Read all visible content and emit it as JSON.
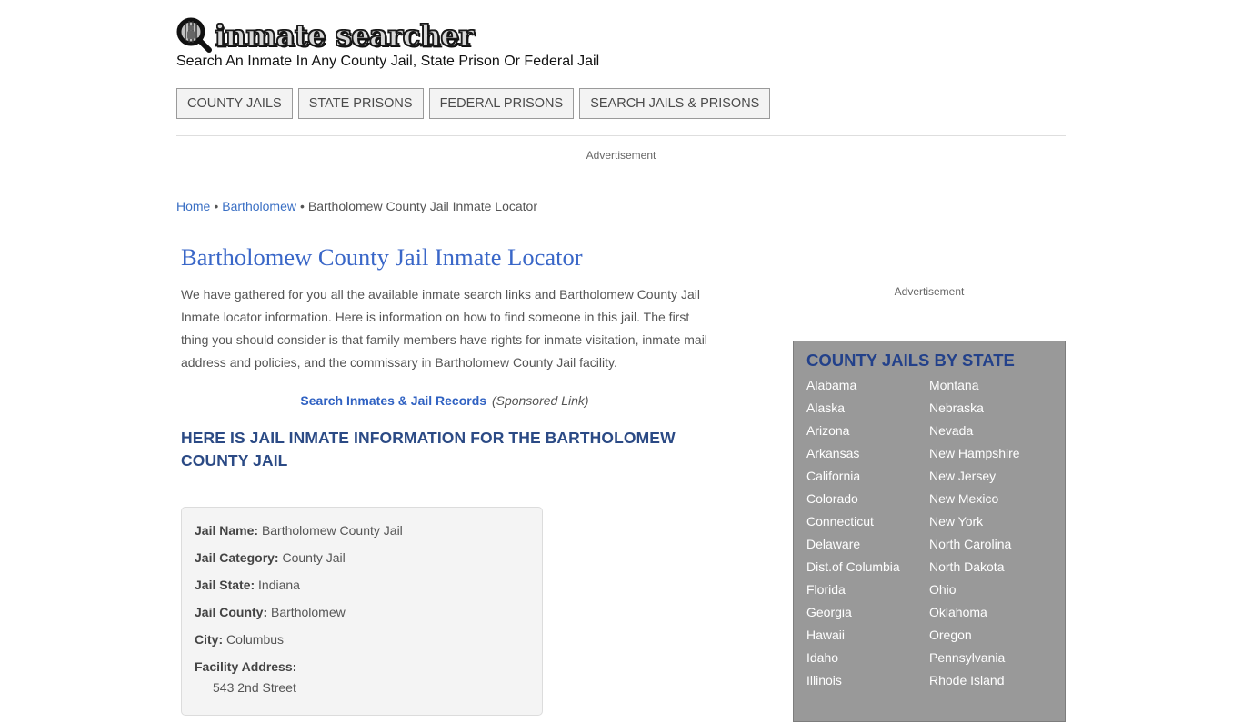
{
  "header": {
    "logo_text": "inmate searcher",
    "tagline": "Search An Inmate In Any County Jail, State Prison Or Federal Jail"
  },
  "nav": {
    "items": [
      {
        "label": "COUNTY JAILS"
      },
      {
        "label": "STATE PRISONS"
      },
      {
        "label": "FEDERAL PRISONS"
      },
      {
        "label": "SEARCH JAILS & PRISONS"
      }
    ]
  },
  "ads": {
    "top_label": "Advertisement",
    "side_label": "Advertisement"
  },
  "breadcrumb": {
    "home": "Home",
    "county": "Bartholomew",
    "current": "Bartholomew County Jail Inmate Locator",
    "separator": "•"
  },
  "main": {
    "title": "Bartholomew County Jail Inmate Locator",
    "intro": "We have gathered for you all the available inmate search links and Bartholomew County Jail Inmate locator information. Here is information on how to find someone in this jail. The first thing you should consider is that family members have rights for inmate visitation, inmate mail address and policies, and the commissary in Bartholomew County Jail facility.",
    "sponsored_link": "Search Inmates & Jail Records",
    "sponsored_note": "(Sponsored Link)",
    "section_heading": "HERE IS JAIL INMATE INFORMATION FOR THE BARTHOLOMEW COUNTY JAIL"
  },
  "info": {
    "jail_name_label": "Jail Name:",
    "jail_name": "Bartholomew County Jail",
    "category_label": "Jail Category:",
    "category": "County Jail",
    "state_label": "Jail State:",
    "state": "Indiana",
    "county_label": "Jail County:",
    "county": "Bartholomew",
    "city_label": "City:",
    "city": "Columbus",
    "address_label": "Facility Address:",
    "address_line1": "543 2nd Street"
  },
  "sidebar": {
    "title": "COUNTY JAILS BY STATE",
    "states_left": [
      "Alabama",
      "Alaska",
      "Arizona",
      "Arkansas",
      "California",
      "Colorado",
      "Connecticut",
      "Delaware",
      "Dist.of Columbia",
      "Florida",
      "Georgia",
      "Hawaii",
      "Idaho",
      "Illinois"
    ],
    "states_right": [
      "Montana",
      "Nebraska",
      "Nevada",
      "New Hampshire",
      "New Jersey",
      "New Mexico",
      "New York",
      "North Carolina",
      "North Dakota",
      "Ohio",
      "Oklahoma",
      "Oregon",
      "Pennsylvania",
      "Rhode Island"
    ]
  }
}
